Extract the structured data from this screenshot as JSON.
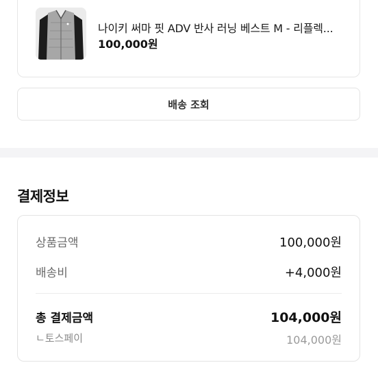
{
  "product": {
    "name": "나이키 써마 핏 ADV 반사 러닝 베스트 M - 리플렉...",
    "price": "100,000원"
  },
  "track_button_label": "배송 조회",
  "payment": {
    "section_title": "결제정보",
    "rows": [
      {
        "label": "상품금액",
        "value": "100,000원"
      },
      {
        "label": "배송비",
        "value": "+4,000원"
      }
    ],
    "total": {
      "label": "총 결제금액",
      "value": "104,000원"
    },
    "method": {
      "label": "ㄴ토스페이",
      "value": "104,000원"
    }
  }
}
